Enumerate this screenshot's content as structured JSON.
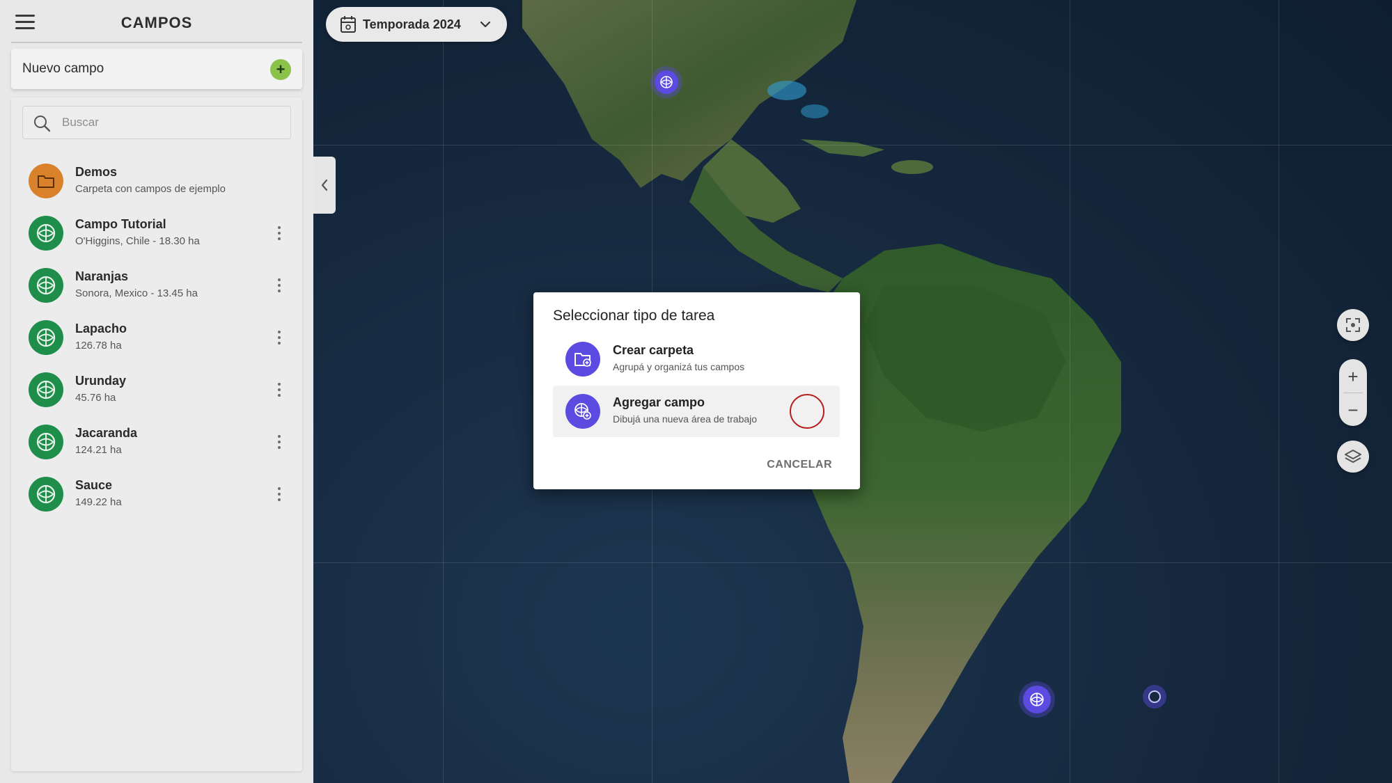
{
  "sidebar": {
    "title": "CAMPOS",
    "new_field_label": "Nuevo campo",
    "search_placeholder": "Buscar",
    "items": [
      {
        "name": "Demos",
        "subtitle": "Carpeta con campos de ejemplo",
        "type": "folder",
        "icon": "folder-icon"
      },
      {
        "name": "Campo Tutorial",
        "subtitle": "O'Higgins, Chile - 18.30 ha",
        "type": "field",
        "icon": "field-icon"
      },
      {
        "name": "Naranjas",
        "subtitle": "Sonora, Mexico - 13.45 ha",
        "type": "field",
        "icon": "field-icon"
      },
      {
        "name": "Lapacho",
        "subtitle": "126.78 ha",
        "type": "field",
        "icon": "field-icon"
      },
      {
        "name": "Urunday",
        "subtitle": "45.76 ha",
        "type": "field",
        "icon": "field-icon"
      },
      {
        "name": "Jacaranda",
        "subtitle": "124.21 ha",
        "type": "field",
        "icon": "field-icon"
      },
      {
        "name": "Sauce",
        "subtitle": "149.22 ha",
        "type": "field",
        "icon": "field-icon"
      }
    ]
  },
  "season": {
    "label": "Temporada 2024",
    "icon": "calendar-icon"
  },
  "dialog": {
    "title": "Seleccionar tipo de tarea",
    "options": [
      {
        "title": "Crear carpeta",
        "description": "Agrupá y organizá tus campos",
        "icon": "folder-add-icon",
        "selected": false
      },
      {
        "title": "Agregar campo",
        "description": "Dibujá una nueva área de trabajo",
        "icon": "field-add-icon",
        "selected": true
      }
    ],
    "cancel_label": "CANCELAR"
  },
  "map_controls": {
    "zoom_in": "+",
    "zoom_out": "−"
  },
  "colors": {
    "accent": "#5b4be0",
    "field_green": "#1e8e4a",
    "folder_orange": "#d9822b",
    "add_green": "#8bc34a",
    "radio_red": "#b71c1c"
  }
}
